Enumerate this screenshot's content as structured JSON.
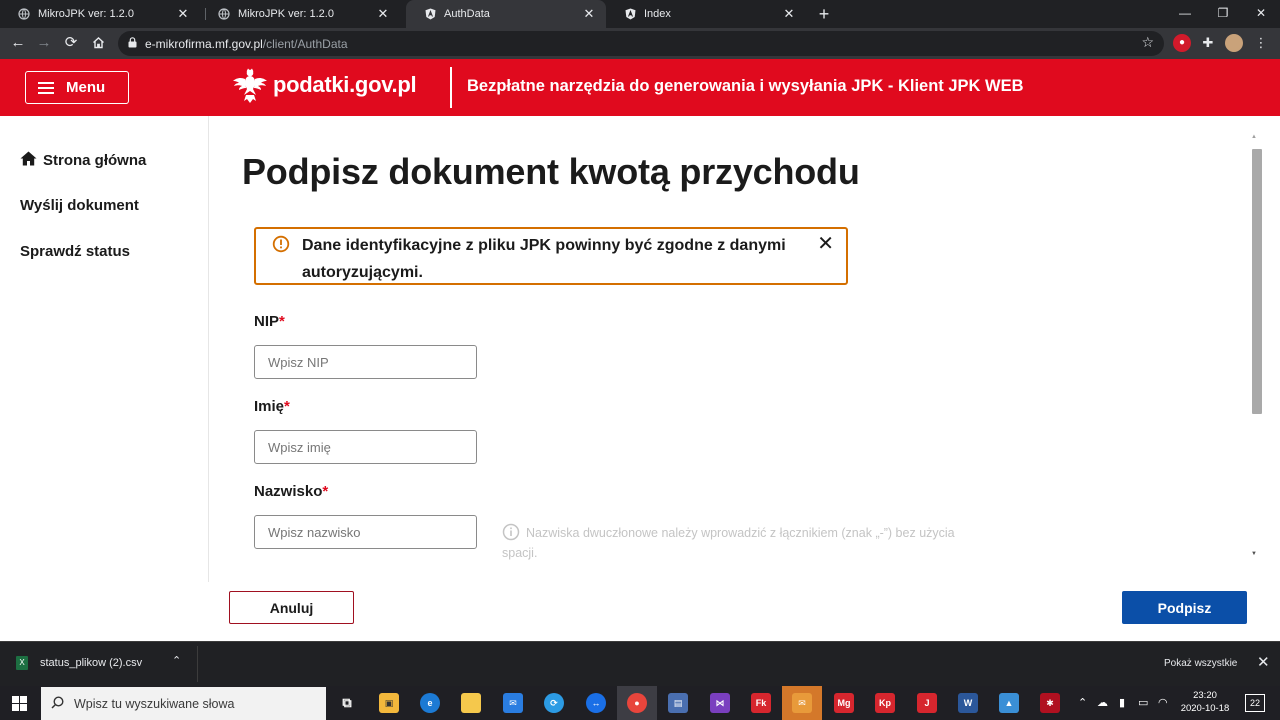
{
  "browser": {
    "tabs": [
      {
        "label": "MikroJPK ver: 1.2.0",
        "icon": "globe-icon",
        "active": false
      },
      {
        "label": "MikroJPK ver: 1.2.0",
        "icon": "globe-icon",
        "active": false
      },
      {
        "label": "AuthData",
        "icon": "angular-icon",
        "active": true
      },
      {
        "label": "Index",
        "icon": "angular-icon",
        "active": false
      }
    ],
    "url_host": "e-mikrofirma.mf.gov.pl",
    "url_path": "/client/AuthData"
  },
  "header": {
    "menu_label": "Menu",
    "logo_text": "podatki.gov.pl",
    "subtitle": "Bezpłatne narzędzia do generowania i wysyłania JPK - Klient JPK WEB",
    "brand_color": "#e00a1e"
  },
  "sidebar": {
    "items": [
      {
        "label": "Strona główna",
        "icon": "home-icon"
      },
      {
        "label": "Wyślij dokument"
      },
      {
        "label": "Sprawdź status"
      }
    ]
  },
  "main": {
    "title": "Podpisz dokument kwotą przychodu",
    "alert": {
      "text": "Dane identyfikacyjne z pliku JPK powinny być zgodne z danymi autoryzującymi.",
      "color": "#d46f00"
    },
    "fields": [
      {
        "label": "NIP",
        "required_mark": "*",
        "placeholder": "Wpisz NIP",
        "value": ""
      },
      {
        "label": "Imię",
        "required_mark": "*",
        "placeholder": "Wpisz imię",
        "value": ""
      },
      {
        "label": "Nazwisko",
        "required_mark": "*",
        "placeholder": "Wpisz nazwisko",
        "value": ""
      }
    ],
    "surname_hint": "Nazwiska dwuczłonowe należy wprowadzić z łącznikiem (znak „-”) bez użycia spacji."
  },
  "footer": {
    "cancel_label": "Anuluj",
    "sign_label": "Podpisz",
    "primary_color": "#0b4fa8"
  },
  "download_bar": {
    "file_name": "status_plikow (2).csv",
    "show_all_label": "Pokaż wszystkie"
  },
  "taskbar": {
    "search_placeholder": "Wpisz tu wyszukiwane słowa",
    "time": "23:20",
    "date": "2020-10-18",
    "notification_count": "22"
  }
}
